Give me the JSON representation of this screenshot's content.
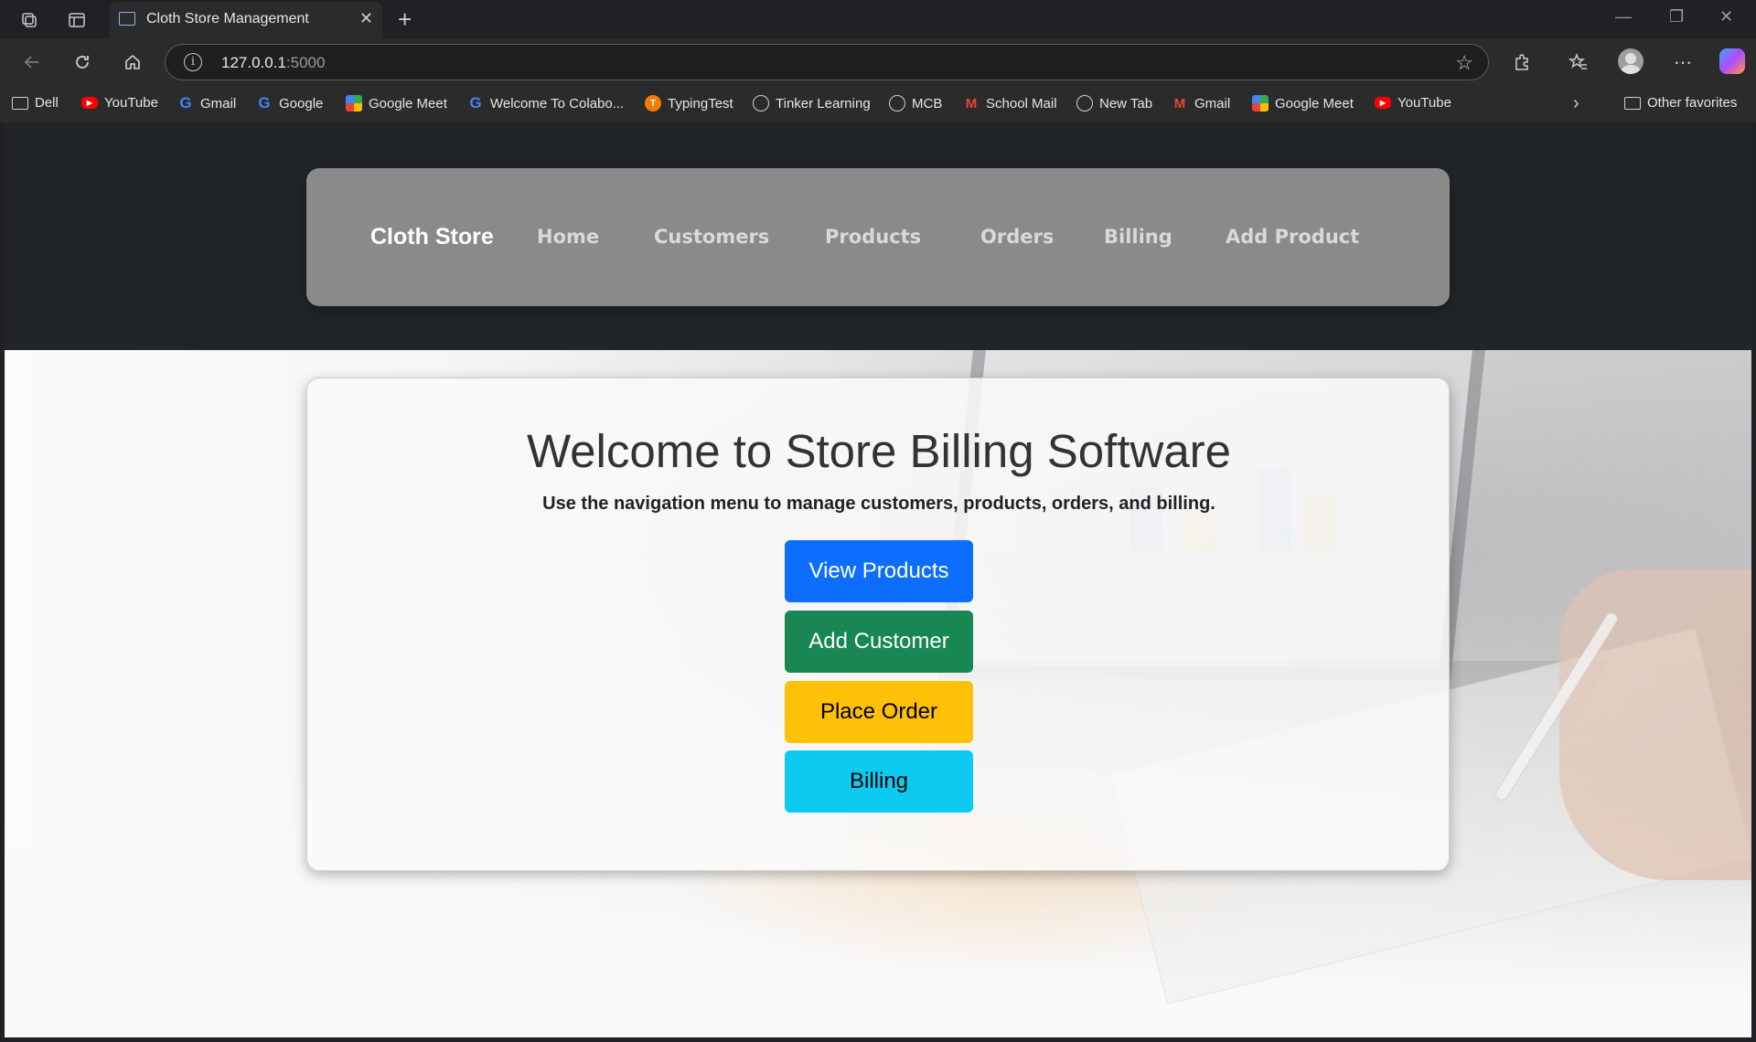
{
  "browser": {
    "tab_title": "Cloth Store Management",
    "url_host": "127.0.0.1",
    "url_port": ":5000",
    "bookmarks": [
      {
        "label": "Dell",
        "icon": "folder-icon"
      },
      {
        "label": "YouTube",
        "icon": "youtube-icon"
      },
      {
        "label": "Gmail",
        "icon": "google-icon"
      },
      {
        "label": "Google",
        "icon": "google-icon"
      },
      {
        "label": "Google Meet",
        "icon": "google-meet-icon"
      },
      {
        "label": "Welcome To Colabo...",
        "icon": "google-icon"
      },
      {
        "label": "TypingTest",
        "icon": "typingtest-icon"
      },
      {
        "label": "Tinker Learning",
        "icon": "globe-icon"
      },
      {
        "label": "MCB",
        "icon": "globe-icon"
      },
      {
        "label": "School Mail",
        "icon": "gmail-icon"
      },
      {
        "label": "New Tab",
        "icon": "globe-icon"
      },
      {
        "label": "Gmail",
        "icon": "gmail-icon"
      },
      {
        "label": "Google Meet",
        "icon": "google-meet-icon"
      },
      {
        "label": "YouTube",
        "icon": "youtube-icon"
      }
    ],
    "other_favorites": "Other favorites"
  },
  "navbar": {
    "brand": "Cloth Store",
    "links": [
      "Home",
      "Customers",
      "Products",
      "Orders",
      "Billing",
      "Add Product"
    ]
  },
  "main": {
    "heading": "Welcome to Store Billing Software",
    "subtitle": "Use the navigation menu to manage customers, products, orders, and billing.",
    "buttons": [
      {
        "label": "View Products",
        "color": "#0d6efd"
      },
      {
        "label": "Add Customer",
        "color": "#198754"
      },
      {
        "label": "Place Order",
        "color": "#ffc107"
      },
      {
        "label": "Billing",
        "color": "#0dcaf0"
      }
    ]
  },
  "colors": {
    "header_bg": "#212529",
    "navbar_bg": "#8a8a8a"
  }
}
